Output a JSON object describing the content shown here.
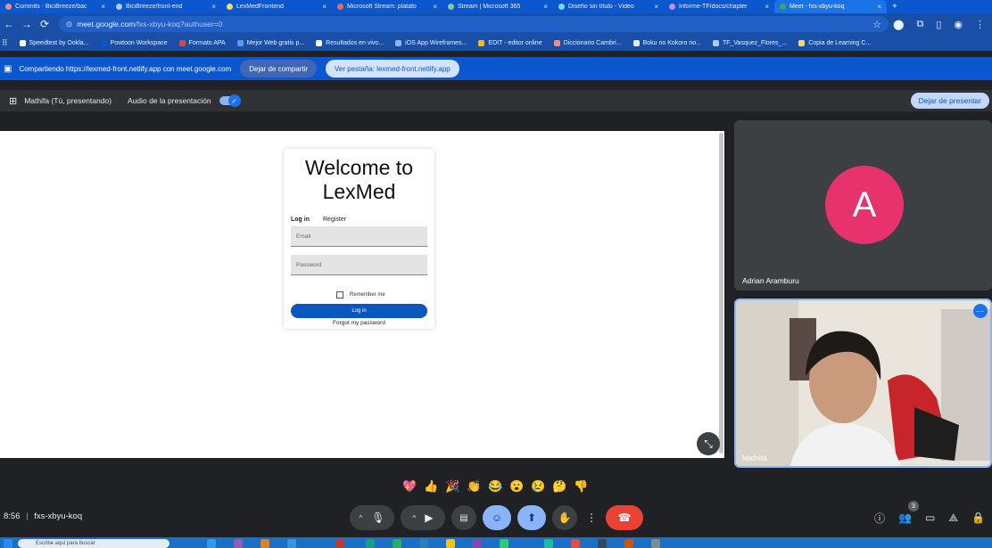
{
  "browser": {
    "tabs": [
      {
        "title": "Commits · BiciBreeze/bac",
        "active": false,
        "color": "#f28b82"
      },
      {
        "title": "BiciBreeze/front-end",
        "active": false,
        "color": "#aecbfa"
      },
      {
        "title": "LexMedFrontend",
        "active": false,
        "color": "#fdd663"
      },
      {
        "title": "Microsoft Stream: platafo",
        "active": false,
        "color": "#ee675c"
      },
      {
        "title": "Stream | Microsoft 365",
        "active": false,
        "color": "#81c995"
      },
      {
        "title": "Diseño sin título - Video",
        "active": false,
        "color": "#78d9ec"
      },
      {
        "title": "Informe-TF/docs/chapter",
        "active": false,
        "color": "#c58af9"
      },
      {
        "title": "Meet - fxs-xbyu-koq",
        "active": true,
        "color": "#34a853"
      }
    ],
    "url_host": "meet.google.com",
    "url_path": "/fxs-xbyu-koq?authuser=0",
    "bookmarks": [
      {
        "label": "Speedtest by Ookla...",
        "color": "#ffffff"
      },
      {
        "label": "Powtoon Workspace",
        "color": "#0b57d0"
      },
      {
        "label": "Formato APA",
        "color": "#ea4335"
      },
      {
        "label": "Mejor Web gratis p...",
        "color": "#5e97f6"
      },
      {
        "label": "Resultados en vivo...",
        "color": "#ffffff"
      },
      {
        "label": "iOS App Wireframes...",
        "color": "#8ab4f8"
      },
      {
        "label": "EDIT - editor online",
        "color": "#fbbc04"
      },
      {
        "label": "Diccionario Cambri...",
        "color": "#f28b82"
      },
      {
        "label": "Boku no Kokoro no...",
        "color": "#e8eaed"
      },
      {
        "label": "TF_Vasquez_Flores_...",
        "color": "#aecbfa"
      },
      {
        "label": "Copia de Learning C...",
        "color": "#fdd663"
      }
    ]
  },
  "share_bar": {
    "text": "Compartiendo https://lexmed-front.netlify.app con meet.google.com",
    "stop_sharing": "Dejar de compartir",
    "view_tab": "Ver pestaña: lexmed-front.netlify.app"
  },
  "presenting_bar": {
    "presenter": "Mathifa (Tú, presentando)",
    "audio_label": "Audio de la presentación",
    "stop_presenting": "Dejar de presentar"
  },
  "login": {
    "title": "Welcome to LexMed",
    "tab_login": "Log in",
    "tab_register": "Register",
    "email_placeholder": "Email",
    "password_placeholder": "Password",
    "remember_me": "Remember me",
    "login_button": "Log in",
    "forgot_password": "Forgot my password"
  },
  "participants": {
    "adrian": {
      "name": "Adrian Aramburu",
      "initial": "A",
      "avatar_color": "#e8326e"
    },
    "mathifa": {
      "name": "Mathifa"
    }
  },
  "reactions": [
    "💖",
    "👍",
    "🎉",
    "👏",
    "😂",
    "😮",
    "😢",
    "🤔",
    "👎"
  ],
  "meeting": {
    "time": "8:56",
    "code": "fxs-xbyu-koq",
    "people_count": "3"
  },
  "taskbar": {
    "search_placeholder": "Escribe aquí para buscar"
  }
}
